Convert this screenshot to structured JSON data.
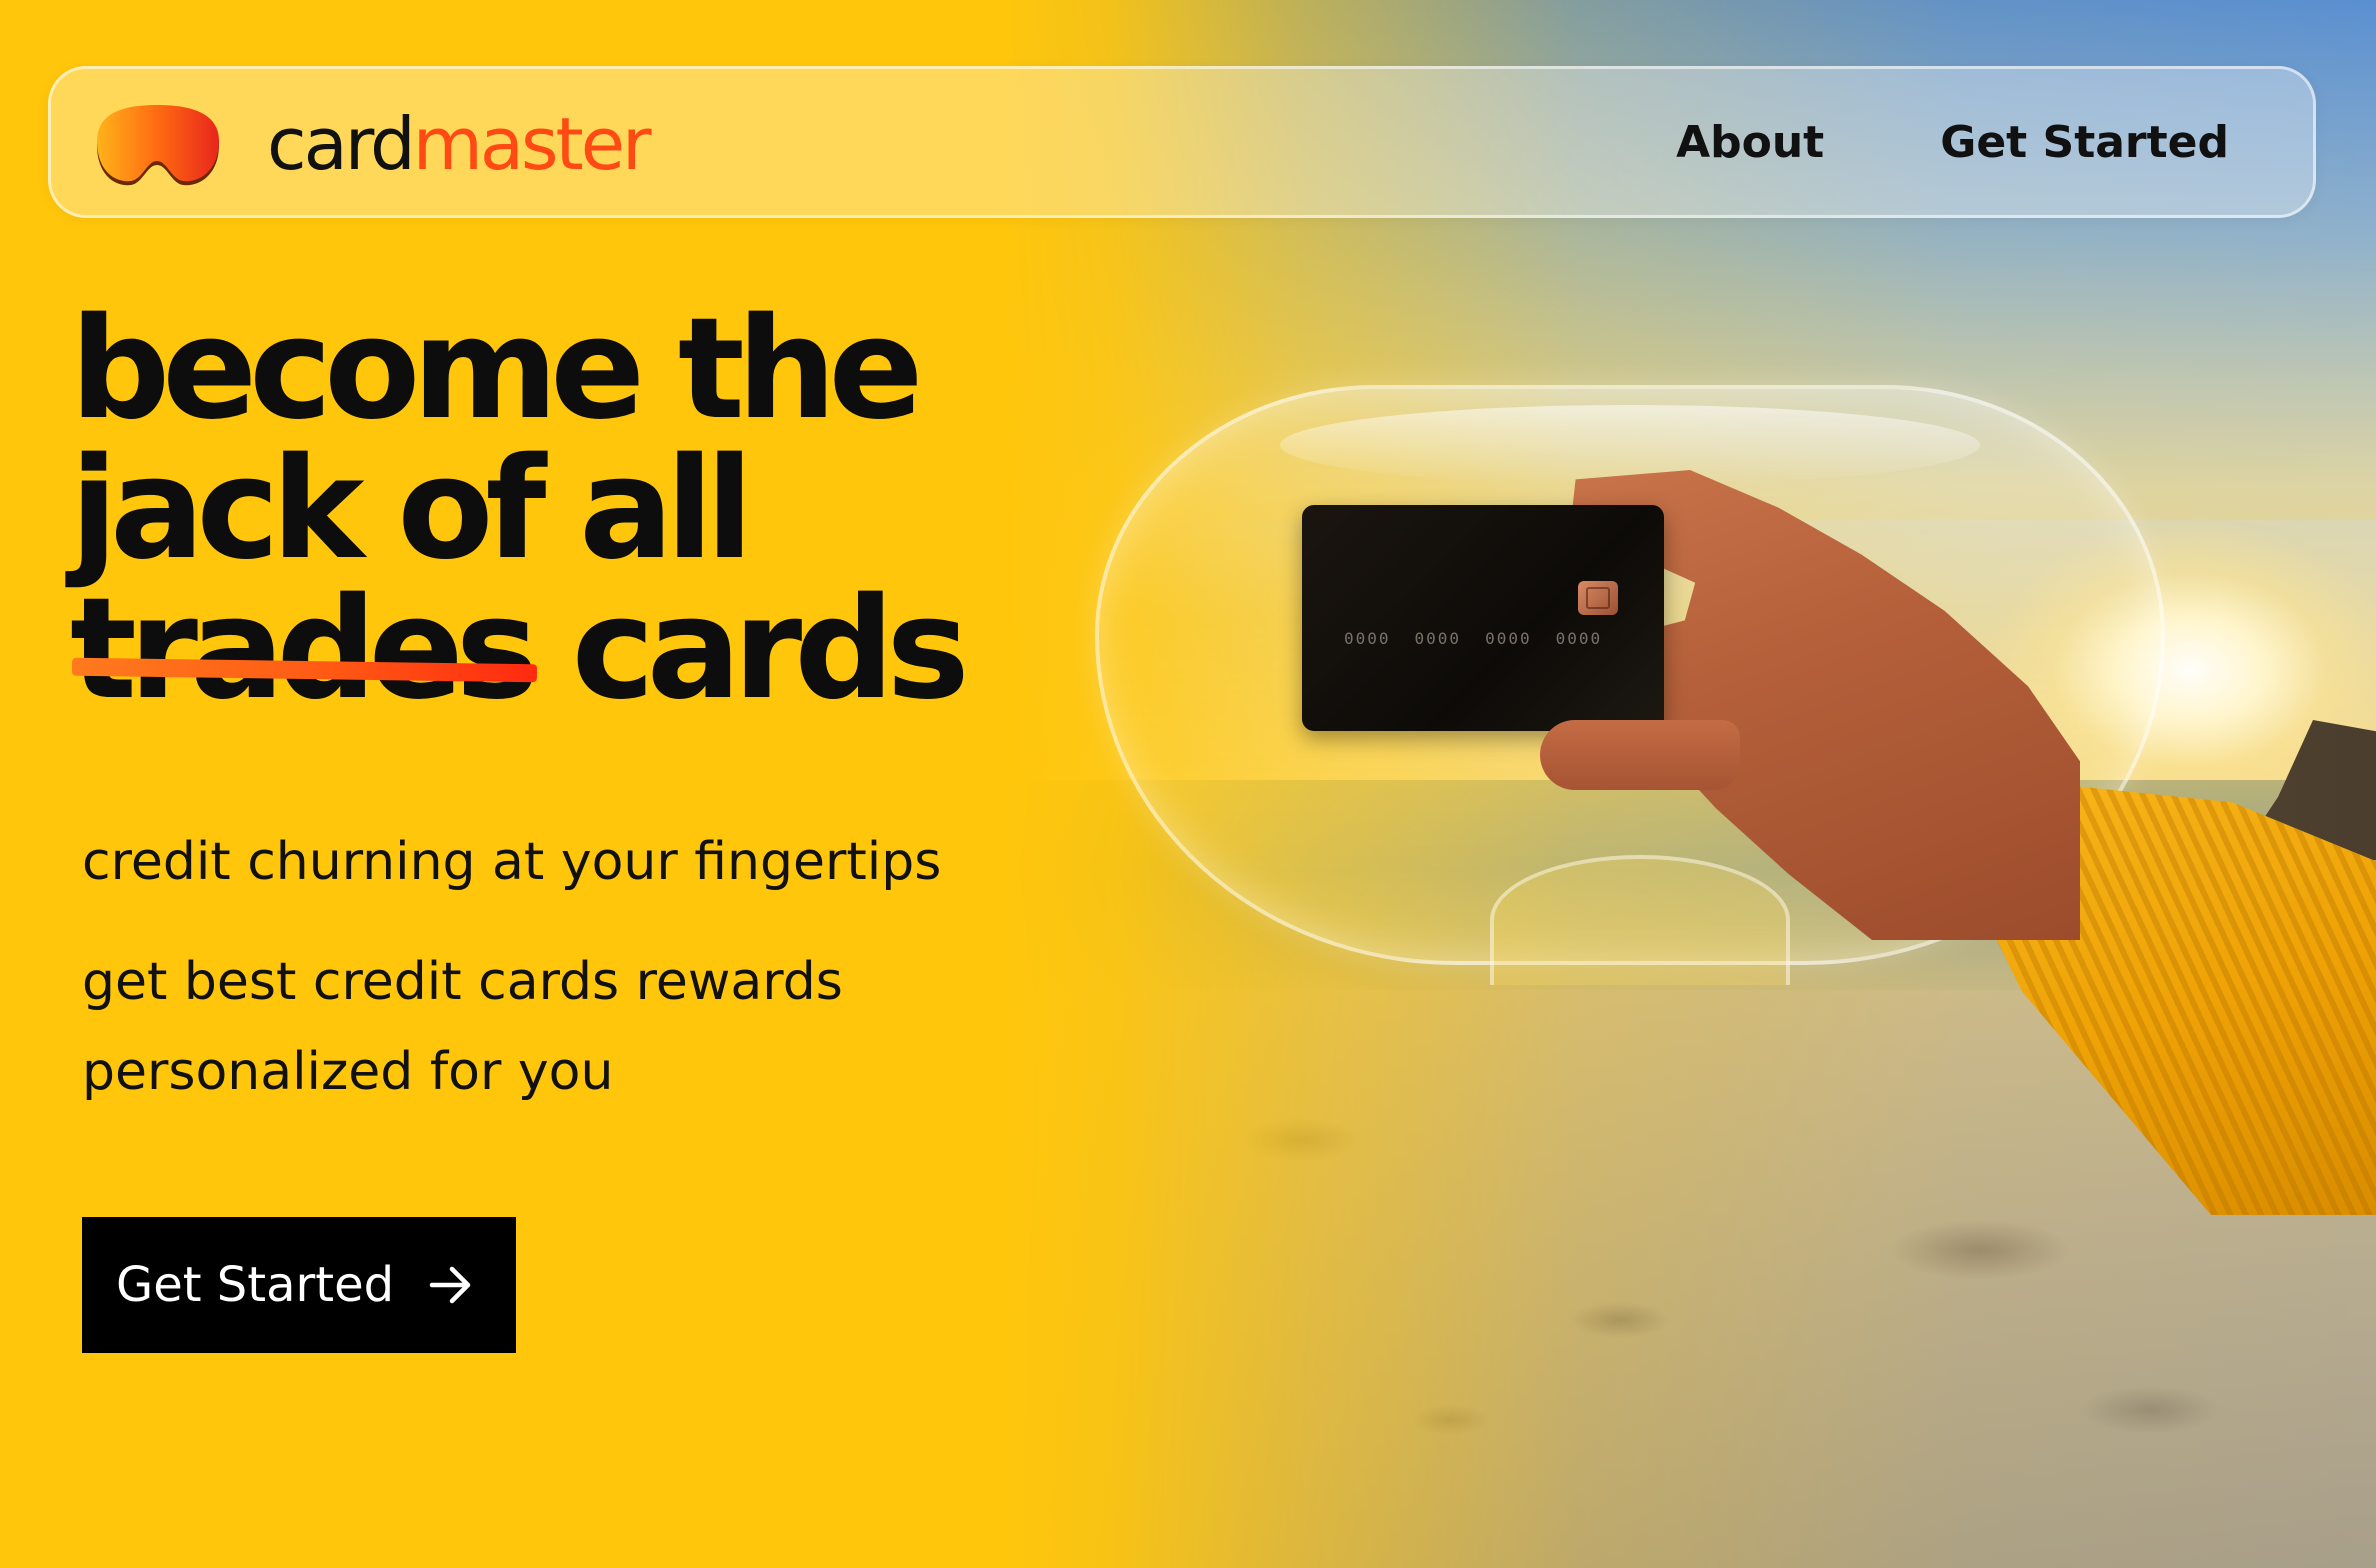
{
  "brand": {
    "name_part1": "card",
    "name_part2": "master",
    "accent_color": "#FF4A14",
    "background_color": "#FFC60B"
  },
  "nav": {
    "links": [
      {
        "label": "About"
      },
      {
        "label": "Get Started"
      }
    ]
  },
  "hero": {
    "title_line1": "become the",
    "title_line2": "jack of all",
    "title_struck_word": "trades",
    "title_replacement_word": "cards",
    "subtitle": "credit churning at your fingertips",
    "description_line1": "get best credit cards rewards",
    "description_line2": "personalized for you",
    "cta_label": "Get Started",
    "cta_icon": "arrow-right-icon"
  },
  "card_visual": {
    "number_groups": [
      "0000",
      "0000",
      "0000",
      "0000"
    ]
  }
}
